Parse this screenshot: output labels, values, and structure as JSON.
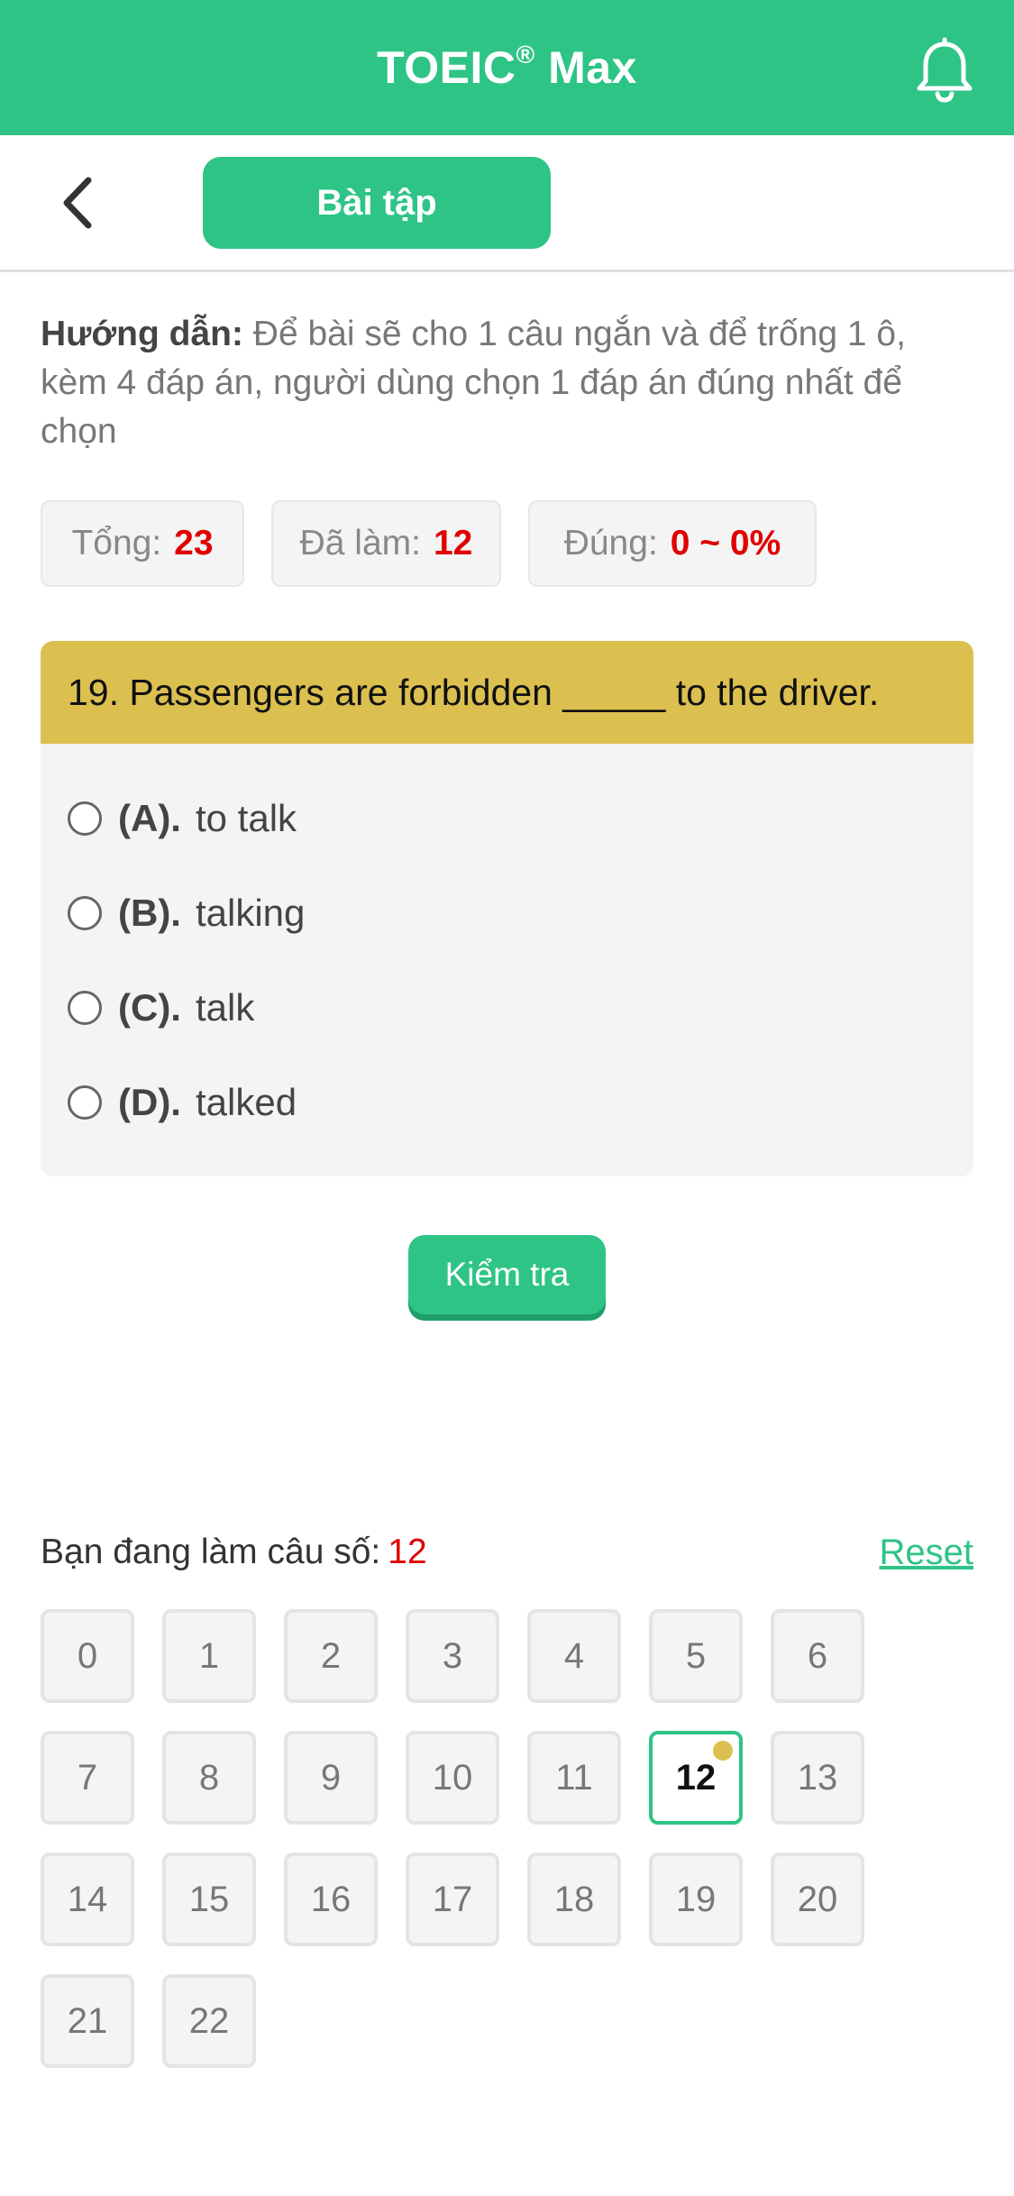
{
  "header": {
    "title": "TOEIC",
    "title_mark": "®",
    "title_suffix": " Max",
    "notification_icon": "bell-icon"
  },
  "subbar": {
    "back_icon": "chevron-left-icon",
    "tab_label": "Bài tập"
  },
  "instructions": {
    "label": "Hướng dẫn:",
    "text": " Để bài sẽ cho 1 câu ngắn và để trống 1 ô, kèm 4 đáp án, người dùng chọn 1 đáp án đúng nhất để chọn"
  },
  "stats": {
    "total_label": "Tổng:",
    "total_value": "23",
    "done_label": "Đã làm:",
    "done_value": "12",
    "correct_label": "Đúng:",
    "correct_value": "0 ~ 0%"
  },
  "question": {
    "text": "19. Passengers are forbidden _____ to the driver.",
    "options": [
      {
        "key": "(A).",
        "text": "to talk"
      },
      {
        "key": "(B).",
        "text": "talking"
      },
      {
        "key": "(C).",
        "text": "talk"
      },
      {
        "key": "(D).",
        "text": "talked"
      }
    ]
  },
  "check_button": "Kiểm tra",
  "progress": {
    "label": "Bạn đang làm câu số:",
    "current": "12",
    "reset": "Reset"
  },
  "question_numbers": [
    "0",
    "1",
    "2",
    "3",
    "4",
    "5",
    "6",
    "7",
    "8",
    "9",
    "10",
    "11",
    "12",
    "13",
    "14",
    "15",
    "16",
    "17",
    "18",
    "19",
    "20",
    "21",
    "22"
  ],
  "active_question": "12",
  "colors": {
    "brand": "#2ec486",
    "question_header": "#dbc050",
    "highlight": "#e00000"
  }
}
